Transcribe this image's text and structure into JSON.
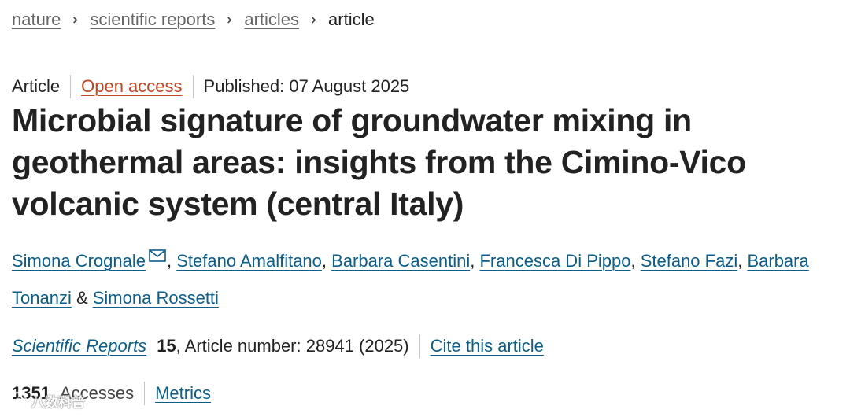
{
  "breadcrumb": {
    "items": [
      "nature",
      "scientific reports",
      "articles"
    ],
    "current": "article"
  },
  "meta": {
    "type": "Article",
    "access": "Open access",
    "published": "Published: 07 August 2025"
  },
  "title": "Microbial signature of groundwater mixing in geothermal areas: insights from the Cimino-Vico volcanic system (central Italy)",
  "authors": [
    "Simona Crognale",
    "Stefano Amalfitano",
    "Barbara Casentini",
    "Francesca Di Pippo",
    "Stefano Fazi",
    "Barbara Tonanzi",
    "Simona Rossetti"
  ],
  "author_separators": [
    ", ",
    ", ",
    ", ",
    ", ",
    ", ",
    " & "
  ],
  "citation": {
    "journal": "Scientific Reports",
    "volume": "15",
    "details": ", Article number: 28941 (2025)",
    "cite_label": "Cite this article"
  },
  "metrics": {
    "accesses_count": "1351",
    "accesses_label": "Accesses",
    "metrics_label": "Metrics"
  },
  "watermark": "八数科普",
  "colors": {
    "link": "#0b5d8a",
    "open_access": "#c0451f",
    "breadcrumb_link": "#666666",
    "text": "#222222"
  },
  "icons": {
    "breadcrumb_separator": "chevron-right-icon",
    "author_contact": "mail-icon"
  }
}
